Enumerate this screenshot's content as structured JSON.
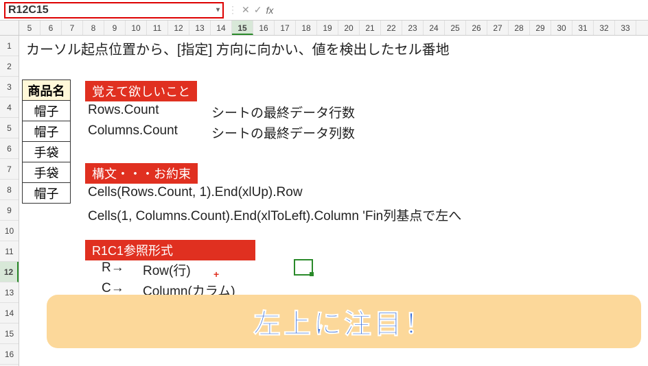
{
  "nameBox": "R12C15",
  "fx": {
    "cancel": "✕",
    "confirm": "✓",
    "label": "fx"
  },
  "colHeaders": [
    "5",
    "6",
    "7",
    "8",
    "9",
    "10",
    "11",
    "12",
    "13",
    "14",
    "15",
    "16",
    "17",
    "18",
    "19",
    "20",
    "21",
    "22",
    "23",
    "24",
    "25",
    "26",
    "27",
    "28",
    "29",
    "30",
    "31",
    "32",
    "33"
  ],
  "activeCol": "15",
  "rowHeaders": [
    "1",
    "2",
    "3",
    "4",
    "5",
    "6",
    "7",
    "8",
    "9",
    "10",
    "11",
    "12",
    "13",
    "14",
    "15",
    "16"
  ],
  "activeRow": "12",
  "title": "カーソル起点位置から、[指定] 方向に向かい、値を検出したセル番地",
  "table": {
    "header": "商品名",
    "rows": [
      "帽子",
      "帽子",
      "手袋",
      "手袋",
      "帽子"
    ]
  },
  "section1": {
    "label": "覚えて欲しいこと",
    "l1a": "Rows.Count",
    "l1b": "シートの最終データ行数",
    "l2a": "Columns.Count",
    "l2b": "シートの最終データ列数"
  },
  "section2": {
    "label": "構文・・・お約束",
    "l1": "Cells(Rows.Count, 1).End(xlUp).Row",
    "l2": "Cells(1, Columns.Count).End(xlToLeft).Column 'Fin列基点で左へ"
  },
  "section3": {
    "label": "R1C1参照形式",
    "l1a": "R→",
    "l1b": "Row(行)",
    "l2a": "C→",
    "l2b": "Column(カラム)"
  },
  "banner": "左上に注目！",
  "plus": "+"
}
